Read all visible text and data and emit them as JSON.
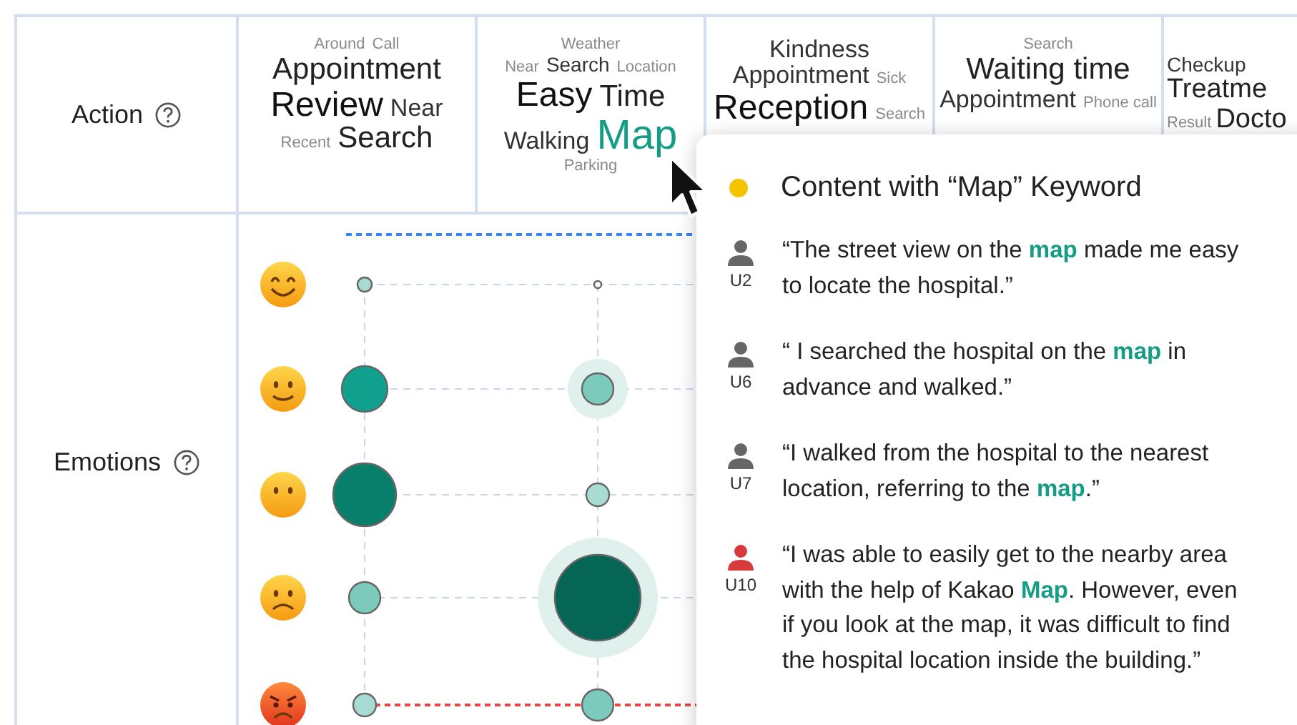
{
  "action": {
    "label": "Action",
    "clouds": [
      {
        "lines": [
          [
            {
              "word": "Around",
              "kind": "xs"
            },
            {
              "word": "Call",
              "kind": "xs"
            }
          ],
          [
            {
              "word": "Appointment",
              "kind": "l"
            }
          ],
          [
            {
              "word": "Review",
              "kind": "xl"
            },
            {
              "word": "Near",
              "kind": "m"
            }
          ],
          [
            {
              "word": "Recent",
              "kind": "xs"
            },
            {
              "word": "Search",
              "kind": "l"
            }
          ]
        ]
      },
      {
        "lines": [
          [
            {
              "word": "Weather",
              "kind": "xs"
            }
          ],
          [
            {
              "word": "Near",
              "kind": "xs"
            },
            {
              "word": "Search",
              "kind": "s"
            },
            {
              "word": "Location",
              "kind": "xs"
            }
          ],
          [
            {
              "word": "Easy",
              "kind": "xl"
            },
            {
              "word": "Time",
              "kind": "l"
            }
          ],
          [
            {
              "word": "Walking",
              "kind": "m"
            },
            {
              "word": "Map",
              "kind": "keyword"
            }
          ],
          [
            {
              "word": "Parking",
              "kind": "xs"
            }
          ]
        ]
      },
      {
        "lines": [
          [
            {
              "word": "Kindness",
              "kind": "m"
            }
          ],
          [
            {
              "word": "Appointment",
              "kind": "m"
            },
            {
              "word": "Sick",
              "kind": "xs"
            }
          ],
          [
            {
              "word": "Reception",
              "kind": "xl"
            },
            {
              "word": "Search",
              "kind": "xs"
            }
          ]
        ]
      },
      {
        "lines": [
          [
            {
              "word": "Search",
              "kind": "xs"
            }
          ],
          [
            {
              "word": "Waiting time",
              "kind": "l"
            }
          ],
          [
            {
              "word": "Appointment",
              "kind": "m"
            },
            {
              "word": "Phone call",
              "kind": "xs"
            }
          ]
        ]
      },
      {
        "lines": [
          [
            {
              "word": "Checkup",
              "kind": "s"
            }
          ],
          [
            {
              "word": "Treatme",
              "kind": "l"
            }
          ],
          [
            {
              "word": "Result",
              "kind": "xs"
            },
            {
              "word": "Docto",
              "kind": "l"
            }
          ]
        ]
      }
    ]
  },
  "emotions": {
    "label": "Emotions",
    "rows": [
      {
        "kind": "grin"
      },
      {
        "kind": "smile"
      },
      {
        "kind": "neutral"
      },
      {
        "kind": "frown"
      },
      {
        "kind": "angry"
      }
    ]
  },
  "popup": {
    "title": "Content with “Map” Keyword",
    "color": "#f5c400",
    "quotes": [
      {
        "user": "U2",
        "color": "#666666",
        "text": "“The street view on the **map** made me easy to locate the hospital.”"
      },
      {
        "user": "U6",
        "color": "#666666",
        "text": "“ I searched the hospital on the **map** in advance and walked.”"
      },
      {
        "user": "U7",
        "color": "#666666",
        "text": "“I walked from the hospital to the nearest location, referring to the **map**.”"
      },
      {
        "user": "U10",
        "color": "#d63a3a",
        "text": "“I was able to easily get to the nearby area with the help of Kakao **Map**. However, even if you look at the map, it was difficult to find the hospital location inside the building.”"
      }
    ]
  }
}
